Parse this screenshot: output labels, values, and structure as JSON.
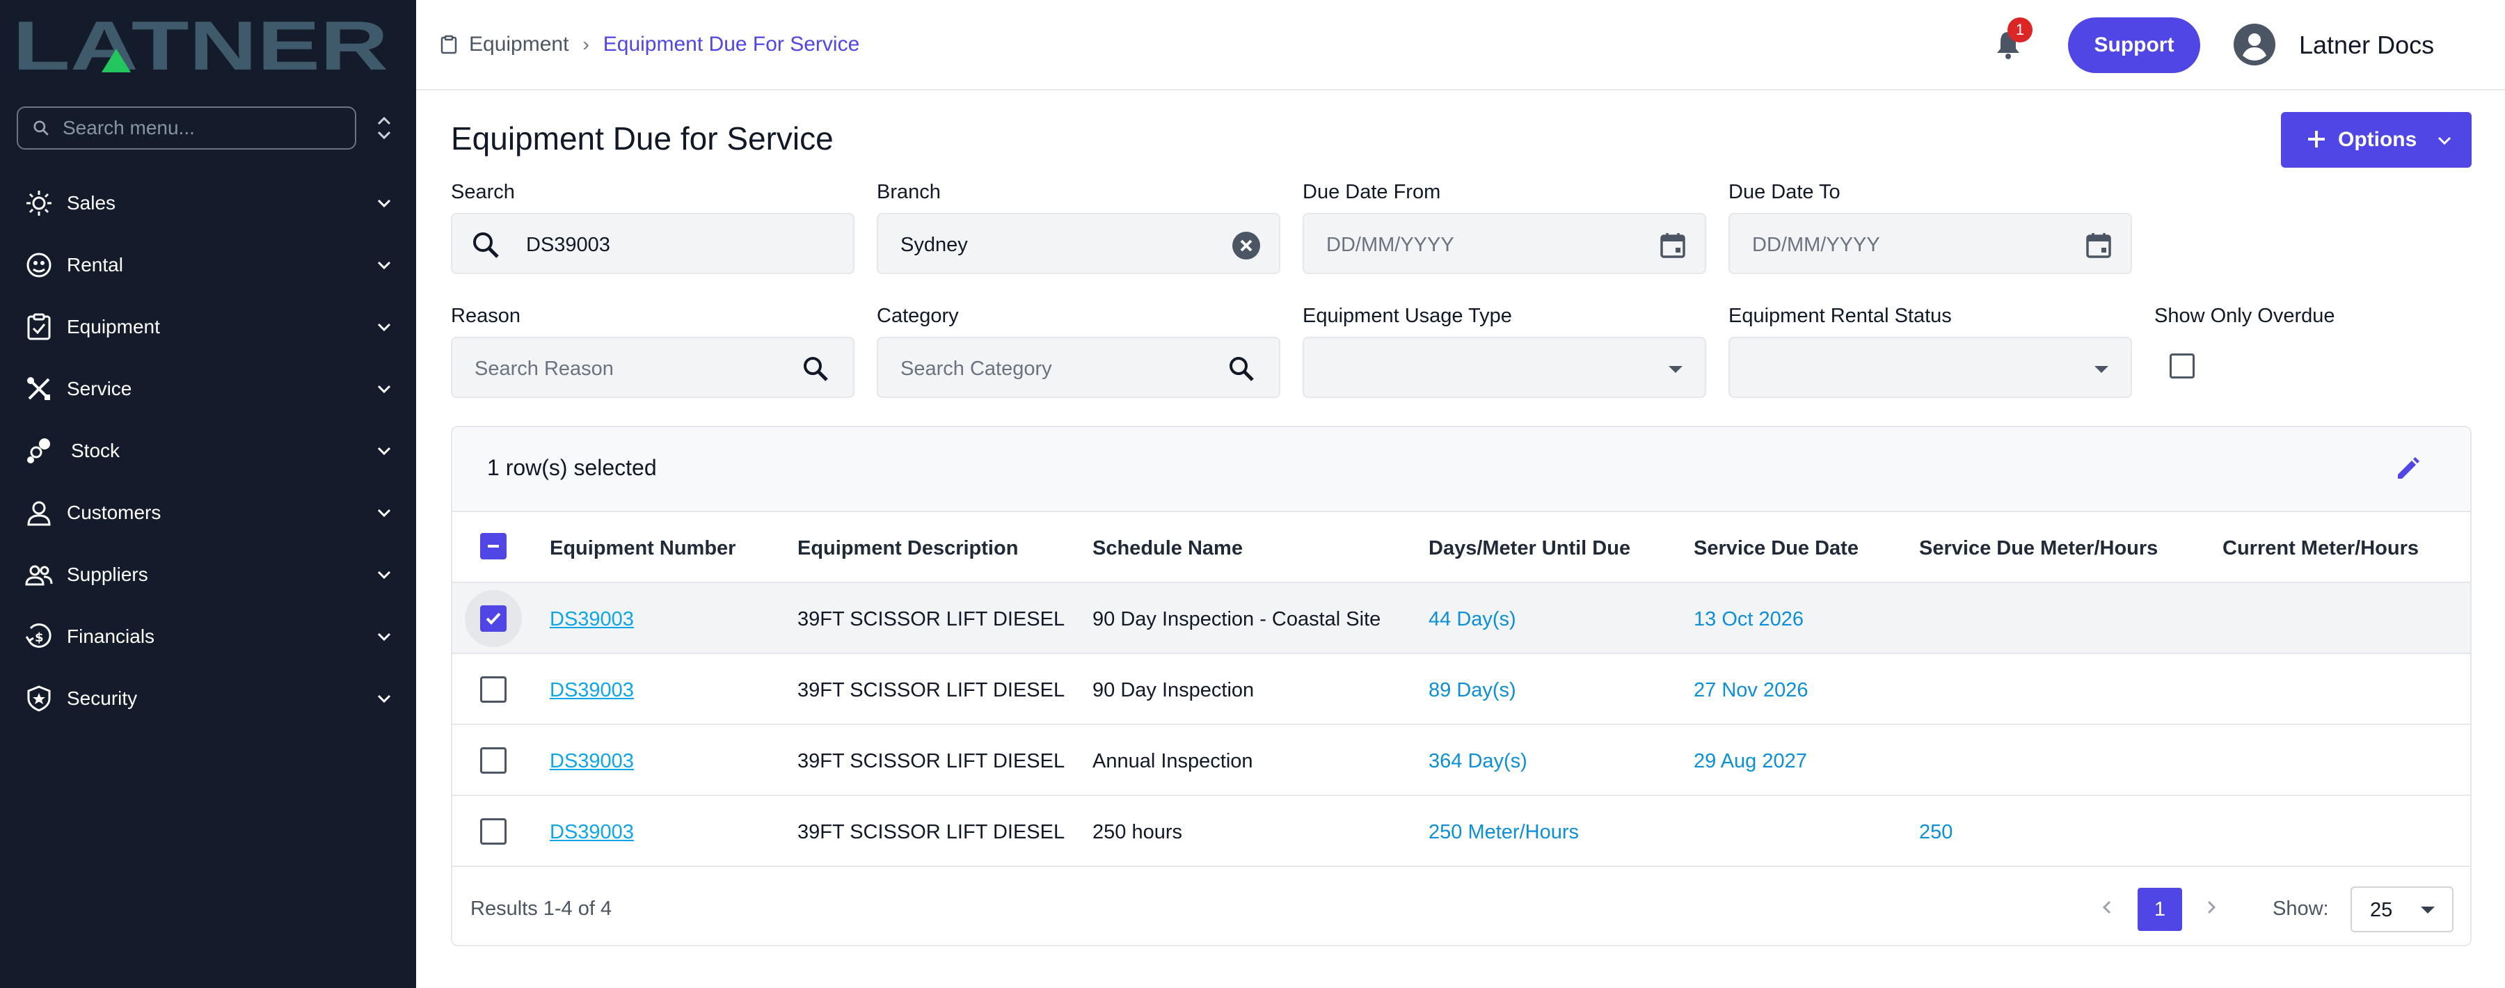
{
  "brand": {
    "logo_text": "LATNER"
  },
  "sidebar": {
    "search_placeholder": "Search menu...",
    "items": [
      {
        "label": "Sales",
        "icon": "sales-icon"
      },
      {
        "label": "Rental",
        "icon": "rental-icon"
      },
      {
        "label": "Equipment",
        "icon": "equipment-icon"
      },
      {
        "label": "Service",
        "icon": "service-icon"
      },
      {
        "label": "Stock",
        "icon": "stock-icon"
      },
      {
        "label": "Customers",
        "icon": "customers-icon"
      },
      {
        "label": "Suppliers",
        "icon": "suppliers-icon"
      },
      {
        "label": "Financials",
        "icon": "financials-icon"
      },
      {
        "label": "Security",
        "icon": "security-icon"
      }
    ]
  },
  "header": {
    "breadcrumb": {
      "root": "Equipment",
      "current": "Equipment Due For Service"
    },
    "notification_count": "1",
    "support_label": "Support",
    "user_name": "Latner Docs"
  },
  "page": {
    "title": "Equipment Due for Service",
    "options_label": "Options"
  },
  "filters": {
    "search": {
      "label": "Search",
      "value": "DS39003"
    },
    "branch": {
      "label": "Branch",
      "value": "Sydney"
    },
    "due_from": {
      "label": "Due Date From",
      "placeholder": "DD/MM/YYYY"
    },
    "due_to": {
      "label": "Due Date To",
      "placeholder": "DD/MM/YYYY"
    },
    "reason": {
      "label": "Reason",
      "placeholder": "Search Reason"
    },
    "category": {
      "label": "Category",
      "placeholder": "Search Category"
    },
    "usage_type": {
      "label": "Equipment Usage Type",
      "value": ""
    },
    "rental_status": {
      "label": "Equipment Rental Status",
      "value": ""
    },
    "overdue": {
      "label": "Show Only Overdue",
      "checked": false
    }
  },
  "table": {
    "selection_text": "1 row(s) selected",
    "columns": [
      "Equipment Number",
      "Equipment Description",
      "Schedule Name",
      "Days/Meter Until Due",
      "Service Due Date",
      "Service Due Meter/Hours",
      "Current Meter/Hours"
    ],
    "rows": [
      {
        "selected": true,
        "number": "DS39003",
        "description": "39FT SCISSOR LIFT DIESEL",
        "schedule": "90 Day Inspection - Coastal Site",
        "until_due": "44 Day(s)",
        "due_date": "13 Oct 2026",
        "due_meter": "",
        "current_meter": ""
      },
      {
        "selected": false,
        "number": "DS39003",
        "description": "39FT SCISSOR LIFT DIESEL",
        "schedule": "90 Day Inspection",
        "until_due": "89 Day(s)",
        "due_date": "27 Nov 2026",
        "due_meter": "",
        "current_meter": ""
      },
      {
        "selected": false,
        "number": "DS39003",
        "description": "39FT SCISSOR LIFT DIESEL",
        "schedule": "Annual Inspection",
        "until_due": "364 Day(s)",
        "due_date": "29 Aug 2027",
        "due_meter": "",
        "current_meter": ""
      },
      {
        "selected": false,
        "number": "DS39003",
        "description": "39FT SCISSOR LIFT DIESEL",
        "schedule": "250 hours",
        "until_due": "250 Meter/Hours",
        "due_date": "",
        "due_meter": "250",
        "current_meter": ""
      }
    ],
    "results_text": "Results 1-4 of 4",
    "current_page": "1",
    "show_label": "Show:",
    "page_size": "25"
  },
  "colors": {
    "accent": "#4f46e5",
    "sidebar_bg": "#141c2c",
    "link": "#0ea5e9",
    "logo": "#3f5a6b",
    "logo_accent": "#22c55e"
  }
}
